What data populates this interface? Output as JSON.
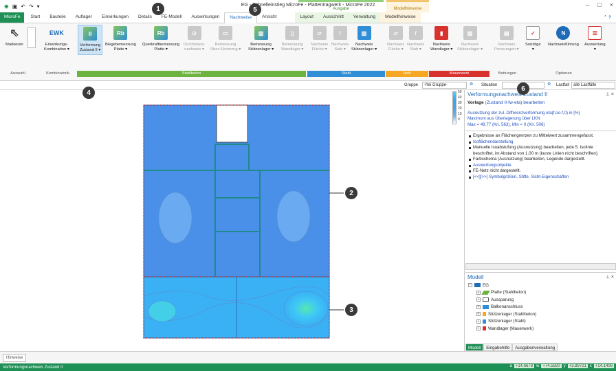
{
  "window": {
    "title": "EG - Schnelleinstieg MicroFe - Plattentragwerk - MicroFe 2022",
    "context_groups": [
      {
        "label": "Ausgabe",
        "color": "#8fd07a"
      },
      {
        "label": "Modellhinweise",
        "color": "#f2c46d"
      }
    ]
  },
  "tabs": [
    "MicroFe",
    "Start",
    "Bauteile",
    "Auflager",
    "Einwirkungen",
    "Details",
    "FE-Modell",
    "Auswirkungen",
    "Nachweise",
    "Ansicht",
    "Layout",
    "Ausschnitt",
    "Verwaltung",
    "Modellhinweise"
  ],
  "active_tab": "Nachweise",
  "ribbon": {
    "buttons": [
      {
        "label": "Markieren",
        "icon": "cursor-icon",
        "enabled": true
      },
      {
        "label": "EWK",
        "icon": "ewk-text-icon",
        "enabled": true
      },
      {
        "label": "Einwirkungs-\nKombination ▾",
        "icon": "",
        "enabled": true
      },
      {
        "label": "Verformung\nZustand II ▾",
        "icon": "verformung-icon",
        "enabled": true
      },
      {
        "label": "Biegebemessung\nPlatte ▾",
        "icon": "biegebemessung-icon",
        "enabled": true
      },
      {
        "label": "Querkraftbemessung\nPlatte ▾",
        "icon": "querkraft-icon",
        "enabled": true
      },
      {
        "label": "Durchstanz-\nnachweis ▾",
        "icon": "durchstanz-icon",
        "enabled": false
      },
      {
        "label": "Bemessung\nÜber-/Unterzug ▾",
        "icon": "unterzug-icon",
        "enabled": false
      },
      {
        "label": "Bemessung\nStützenlager ▾",
        "icon": "stuetzenlager-icon",
        "enabled": true
      },
      {
        "label": "Bemessung\nWandlager ▾",
        "icon": "wandlager-icon",
        "enabled": false
      },
      {
        "label": "Nachweis\nFläche ▾",
        "icon": "stahl-flaeche-icon",
        "enabled": false
      },
      {
        "label": "Nachweis\nStab ▾",
        "icon": "stahl-stab-icon",
        "enabled": false
      },
      {
        "label": "Nachweis\nStützenlager ▾",
        "icon": "stahl-stuetze-icon",
        "enabled": true
      },
      {
        "label": "Nachweis\nFläche ▾",
        "icon": "holz-flaeche-icon",
        "enabled": false
      },
      {
        "label": "Nachweis\nStab ▾",
        "icon": "holz-stab-icon",
        "enabled": false
      },
      {
        "label": "Nachweis\nWandlager ▾",
        "icon": "mauerwerk-wand-icon",
        "enabled": true
      },
      {
        "label": "Nachweis\nStützenlager ▾",
        "icon": "mauerwerk-stuetze-icon",
        "enabled": false
      },
      {
        "label": "Nachweis\nPressungen ▾",
        "icon": "pressungen-icon",
        "enabled": false
      },
      {
        "label": "Sonstige\n▾",
        "icon": "sonstige-icon",
        "enabled": true
      },
      {
        "label": "Nachweisführung",
        "icon": "nachweisfuehrung-icon",
        "enabled": true
      },
      {
        "label": "Auswertung\n▾",
        "icon": "auswertung-icon",
        "enabled": true
      }
    ],
    "groups": [
      {
        "label": "Auswahl",
        "color": "#f7f7f7"
      },
      {
        "label": "Kombinatorik",
        "color": "#f7f7f7"
      },
      {
        "label": "Stahlbeton",
        "color": "#6db33f"
      },
      {
        "label": "Stahl",
        "color": "#2f8ed6"
      },
      {
        "label": "Holz",
        "color": "#f5a623"
      },
      {
        "label": "Mauerwerk",
        "color": "#d8322f"
      },
      {
        "label": "Bettungen",
        "color": "#f7f7f7"
      },
      {
        "label": "Optionen",
        "color": "#f7f7f7"
      }
    ]
  },
  "toolbar2": {
    "gruppe_label": "Gruppe",
    "gruppe_value": "-frei Gruppe-",
    "situation_label": "Situation",
    "lastfall_label": "Lastfall",
    "lastfall_value": "alle Lastfälle"
  },
  "legend": [
    "50",
    "40",
    "30",
    "20",
    "10",
    "0"
  ],
  "panel": {
    "title": "Verformungsnachweis Zustand II",
    "vorlage_prefix": "Vorlage",
    "vorlage_value": "(Zustand II-fw-eta)",
    "vorlage_action": "bearbeiten",
    "line1": "Ausnutzung der zul. Differenzverformung eta(f,oo-f,0) in [%]",
    "line2": "Maximum aus Überlagerung über LKN",
    "line3": "Max = 49.77 (Kn. 563), Min = 0 (Kn. 506)",
    "bullets": [
      "Ergebnisse an Flächengrenzen zu Mittelwert zusammengefasst.",
      "Isoflächendarstellung",
      "Manuelle Isoabstufung (Ausnutzung) bearbeiten, jede 5. Isolinie beschriftet, im Abstand von 1.00 m (kurze Linien nicht beschriften).",
      "Farbschema (Ausnutzung) bearbeiten, Legende dargestellt.",
      "Auswertungsobjekte",
      "FE-Netz nicht dargestellt.",
      "[<<][>>] Symbolgrößen, Stifte, Sicht-Eigenschaften"
    ]
  },
  "model": {
    "title": "Modell",
    "root": "EG",
    "items": [
      "Platte (Stahlbeton)",
      "Aussparung",
      "Balkonanschluss",
      "Stützenlager (Stahlbeton)",
      "Stützenlager (Stahl)",
      "Wandlager (Mauerwerk)"
    ],
    "tabs": [
      "Modell",
      "Eingabehilfe",
      "Ausgabenverwaltung"
    ]
  },
  "hinweise_tab": "Hinweise",
  "status": {
    "text": "Verformungsnachweis Zustand II",
    "coords": [
      {
        "k": "a",
        "v": "+14.6678"
      },
      {
        "k": "w",
        "v": "+74.5920"
      },
      {
        "k": "y",
        "v": "+3.89721"
      },
      {
        "k": "x",
        "v": "+14.1406"
      }
    ]
  },
  "callouts": [
    "1",
    "2",
    "3",
    "4",
    "5",
    "6"
  ]
}
